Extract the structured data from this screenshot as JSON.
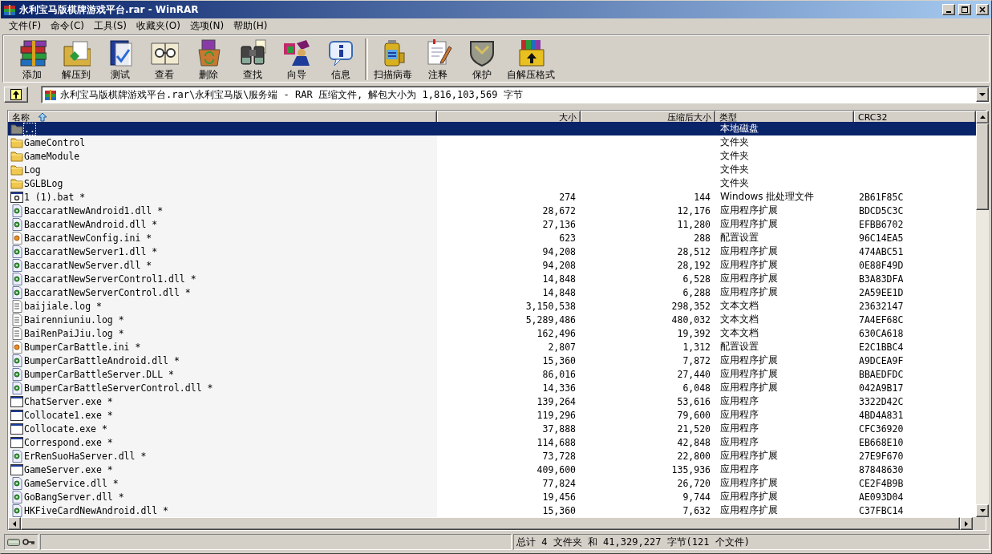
{
  "window": {
    "title": "永利宝马版棋牌游戏平台.rar - WinRAR"
  },
  "menu": [
    "文件(F)",
    "命令(C)",
    "工具(S)",
    "收藏夹(O)",
    "选项(N)",
    "帮助(H)"
  ],
  "toolbar": [
    {
      "label": "添加",
      "kind": "books"
    },
    {
      "label": "解压到",
      "kind": "extract"
    },
    {
      "label": "测试",
      "kind": "test"
    },
    {
      "label": "查看",
      "kind": "view"
    },
    {
      "label": "删除",
      "kind": "delete"
    },
    {
      "label": "查找",
      "kind": "find"
    },
    {
      "label": "向导",
      "kind": "wizard"
    },
    {
      "label": "信息",
      "kind": "info"
    },
    {
      "label": "扫描病毒",
      "kind": "scan",
      "separator_before": true
    },
    {
      "label": "注释",
      "kind": "comment"
    },
    {
      "label": "保护",
      "kind": "protect"
    },
    {
      "label": "自解压格式",
      "kind": "sfx"
    }
  ],
  "address": {
    "path": "永利宝马版棋牌游戏平台.rar\\永利宝马版\\服务端 - RAR 压缩文件, 解包大小为 1,816,103,569 字节"
  },
  "table": {
    "columns": [
      {
        "label": "名称",
        "sorted": true
      },
      {
        "label": "大小",
        "sorted": false
      },
      {
        "label": "压缩后大小",
        "sorted": false
      },
      {
        "label": "类型",
        "sorted": false
      },
      {
        "label": "CRC32",
        "sorted": false
      }
    ],
    "rows": [
      {
        "kind": "parent",
        "name": "..",
        "type": "本地磁盘",
        "selected": true
      },
      {
        "kind": "folder",
        "name": "GameControl",
        "type": "文件夹",
        "selected": false
      },
      {
        "kind": "folder",
        "name": "GameModule",
        "type": "文件夹",
        "selected": false
      },
      {
        "kind": "folder",
        "name": "Log",
        "type": "文件夹",
        "selected": false
      },
      {
        "kind": "folder",
        "name": "SGLBLog",
        "type": "文件夹",
        "selected": false
      },
      {
        "kind": "bat",
        "name": "1 (1).bat *",
        "size": "274",
        "packed": "144",
        "type": "Windows 批处理文件",
        "crc": "2B61F85C",
        "selected": false
      },
      {
        "kind": "dll",
        "name": "BaccaratNewAndroid1.dll *",
        "size": "28,672",
        "packed": "12,176",
        "type": "应用程序扩展",
        "crc": "BDCD5C3C",
        "selected": false
      },
      {
        "kind": "dll",
        "name": "BaccaratNewAndroid.dll *",
        "size": "27,136",
        "packed": "11,280",
        "type": "应用程序扩展",
        "crc": "EFBB6702",
        "selected": false
      },
      {
        "kind": "ini",
        "name": "BaccaratNewConfig.ini *",
        "size": "623",
        "packed": "288",
        "type": "配置设置",
        "crc": "96C14EA5",
        "selected": false
      },
      {
        "kind": "dll",
        "name": "BaccaratNewServer1.dll *",
        "size": "94,208",
        "packed": "28,512",
        "type": "应用程序扩展",
        "crc": "474ABC51",
        "selected": false
      },
      {
        "kind": "dll",
        "name": "BaccaratNewServer.dll *",
        "size": "94,208",
        "packed": "28,192",
        "type": "应用程序扩展",
        "crc": "0E88F49D",
        "selected": false
      },
      {
        "kind": "dll",
        "name": "BaccaratNewServerControl1.dll *",
        "size": "14,848",
        "packed": "6,528",
        "type": "应用程序扩展",
        "crc": "B3A83DFA",
        "selected": false
      },
      {
        "kind": "dll",
        "name": "BaccaratNewServerControl.dll *",
        "size": "14,848",
        "packed": "6,288",
        "type": "应用程序扩展",
        "crc": "2A59EE1D",
        "selected": false
      },
      {
        "kind": "log",
        "name": "baijiale.log *",
        "size": "3,150,538",
        "packed": "298,352",
        "type": "文本文档",
        "crc": "23632147",
        "selected": false
      },
      {
        "kind": "log",
        "name": "Bairenniuniu.log *",
        "size": "5,289,486",
        "packed": "480,032",
        "type": "文本文档",
        "crc": "7A4EF68C",
        "selected": false
      },
      {
        "kind": "log",
        "name": "BaiRenPaiJiu.log *",
        "size": "162,496",
        "packed": "19,392",
        "type": "文本文档",
        "crc": "630CA618",
        "selected": false
      },
      {
        "kind": "ini",
        "name": "BumperCarBattle.ini *",
        "size": "2,807",
        "packed": "1,312",
        "type": "配置设置",
        "crc": "E2C1BBC4",
        "selected": false
      },
      {
        "kind": "dll",
        "name": "BumperCarBattleAndroid.dll *",
        "size": "15,360",
        "packed": "7,872",
        "type": "应用程序扩展",
        "crc": "A9DCEA9F",
        "selected": false
      },
      {
        "kind": "dll",
        "name": "BumperCarBattleServer.DLL *",
        "size": "86,016",
        "packed": "27,440",
        "type": "应用程序扩展",
        "crc": "BBAEDFDC",
        "selected": false
      },
      {
        "kind": "dll",
        "name": "BumperCarBattleServerControl.dll *",
        "size": "14,336",
        "packed": "6,048",
        "type": "应用程序扩展",
        "crc": "042A9B17",
        "selected": false
      },
      {
        "kind": "exe",
        "name": "ChatServer.exe *",
        "size": "139,264",
        "packed": "53,616",
        "type": "应用程序",
        "crc": "3322D42C",
        "selected": false
      },
      {
        "kind": "exe",
        "name": "Collocate1.exe *",
        "size": "119,296",
        "packed": "79,600",
        "type": "应用程序",
        "crc": "4BD4A831",
        "selected": false
      },
      {
        "kind": "exe",
        "name": "Collocate.exe *",
        "size": "37,888",
        "packed": "21,520",
        "type": "应用程序",
        "crc": "CFC36920",
        "selected": false
      },
      {
        "kind": "exe",
        "name": "Correspond.exe *",
        "size": "114,688",
        "packed": "42,848",
        "type": "应用程序",
        "crc": "EB668E10",
        "selected": false
      },
      {
        "kind": "dll",
        "name": "ErRenSuoHaServer.dll *",
        "size": "73,728",
        "packed": "22,800",
        "type": "应用程序扩展",
        "crc": "27E9F670",
        "selected": false
      },
      {
        "kind": "exe",
        "name": "GameServer.exe *",
        "size": "409,600",
        "packed": "135,936",
        "type": "应用程序",
        "crc": "87848630",
        "selected": false
      },
      {
        "kind": "dll",
        "name": "GameService.dll *",
        "size": "77,824",
        "packed": "26,720",
        "type": "应用程序扩展",
        "crc": "CE2F4B9B",
        "selected": false
      },
      {
        "kind": "dll",
        "name": "GoBangServer.dll *",
        "size": "19,456",
        "packed": "9,744",
        "type": "应用程序扩展",
        "crc": "AE093D04",
        "selected": false
      },
      {
        "kind": "dll",
        "name": "HKFiveCardNewAndroid.dll *",
        "size": "15,360",
        "packed": "7,632",
        "type": "应用程序扩展",
        "crc": "C37FBC14",
        "selected": false
      }
    ]
  },
  "status_bar": {
    "summary": "总计 4 文件夹 和 41,329,227 字节(121 个文件)"
  }
}
